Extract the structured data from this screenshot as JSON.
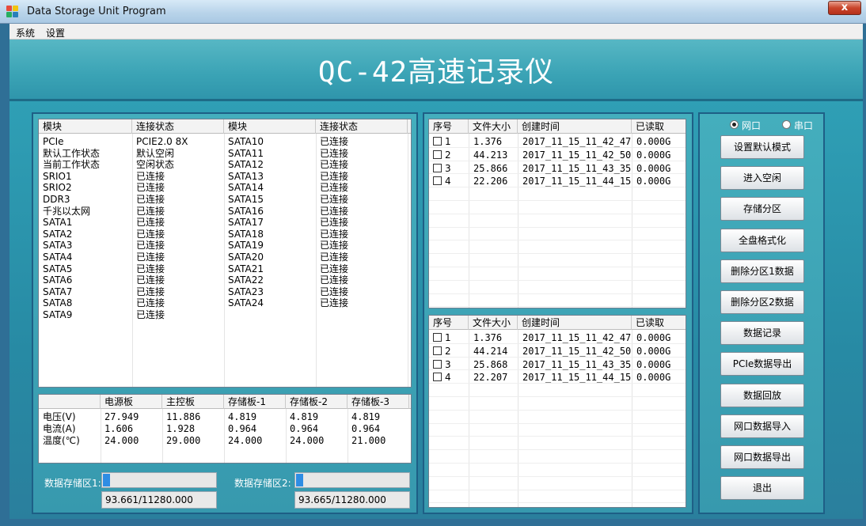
{
  "window": {
    "title": "Data Storage Unit Program",
    "close_label": "x"
  },
  "menu": [
    "系统",
    "设置"
  ],
  "banner_title": "QC-42高速记录仪",
  "modules": {
    "headers": [
      "模块",
      "连接状态",
      "模块",
      "连接状态"
    ],
    "rows": [
      [
        "PCIe",
        "PCIE2.0 8X",
        "SATA10",
        "已连接"
      ],
      [
        "默认工作状态",
        "默认空闲",
        "SATA11",
        "已连接"
      ],
      [
        "当前工作状态",
        "空闲状态",
        "SATA12",
        "已连接"
      ],
      [
        "SRIO1",
        "已连接",
        "SATA13",
        "已连接"
      ],
      [
        "SRIO2",
        "已连接",
        "SATA14",
        "已连接"
      ],
      [
        "DDR3",
        "已连接",
        "SATA15",
        "已连接"
      ],
      [
        "千兆以太网",
        "已连接",
        "SATA16",
        "已连接"
      ],
      [
        "SATA1",
        "已连接",
        "SATA17",
        "已连接"
      ],
      [
        "SATA2",
        "已连接",
        "SATA18",
        "已连接"
      ],
      [
        "SATA3",
        "已连接",
        "SATA19",
        "已连接"
      ],
      [
        "SATA4",
        "已连接",
        "SATA20",
        "已连接"
      ],
      [
        "SATA5",
        "已连接",
        "SATA21",
        "已连接"
      ],
      [
        "SATA6",
        "已连接",
        "SATA22",
        "已连接"
      ],
      [
        "SATA7",
        "已连接",
        "SATA23",
        "已连接"
      ],
      [
        "SATA8",
        "已连接",
        "SATA24",
        "已连接"
      ],
      [
        "SATA9",
        "已连接",
        "",
        ""
      ]
    ]
  },
  "power": {
    "headers": [
      "",
      "电源板",
      "主控板",
      "存储板-1",
      "存储板-2",
      "存储板-3"
    ],
    "rows": [
      [
        "电压(V)",
        "27.949",
        "11.886",
        "4.819",
        "4.819",
        "4.819"
      ],
      [
        "电流(A)",
        "1.606",
        "1.928",
        "0.964",
        "0.964",
        "0.964"
      ],
      [
        "温度(℃)",
        "24.000",
        "29.000",
        "24.000",
        "24.000",
        "21.000"
      ]
    ]
  },
  "storage": {
    "area1": {
      "label": "数据存储区1:",
      "value": "93.661/11280.000",
      "fill_fraction": 0.06
    },
    "area2": {
      "label": "数据存储区2:",
      "value": "93.665/11280.000",
      "fill_fraction": 0.06
    }
  },
  "files1": {
    "headers": [
      "序号",
      "文件大小",
      "创建时间",
      "已读取"
    ],
    "rows": [
      [
        "1",
        "1.376",
        "2017_11_15_11_42_47",
        "0.000G"
      ],
      [
        "2",
        "44.213",
        "2017_11_15_11_42_50",
        "0.000G"
      ],
      [
        "3",
        "25.866",
        "2017_11_15_11_43_35",
        "0.000G"
      ],
      [
        "4",
        "22.206",
        "2017_11_15_11_44_15",
        "0.000G"
      ]
    ]
  },
  "files2": {
    "headers": [
      "序号",
      "文件大小",
      "创建时间",
      "已读取"
    ],
    "rows": [
      [
        "1",
        "1.376",
        "2017_11_15_11_42_47",
        "0.000G"
      ],
      [
        "2",
        "44.214",
        "2017_11_15_11_42_50",
        "0.000G"
      ],
      [
        "3",
        "25.868",
        "2017_11_15_11_43_35",
        "0.000G"
      ],
      [
        "4",
        "22.207",
        "2017_11_15_11_44_15",
        "0.000G"
      ]
    ]
  },
  "interface": {
    "options": [
      "网口",
      "串口"
    ],
    "selected": "网口"
  },
  "buttons": [
    "设置默认模式",
    "进入空闲",
    "存储分区",
    "全盘格式化",
    "删除分区1数据",
    "删除分区2数据",
    "数据记录",
    "PCIe数据导出",
    "数据回放",
    "网口数据导入",
    "网口数据导出",
    "退出"
  ],
  "colors": {
    "banner": "#3aa3b5",
    "frame": "#2f6f96",
    "progress": "#2f8de4"
  }
}
